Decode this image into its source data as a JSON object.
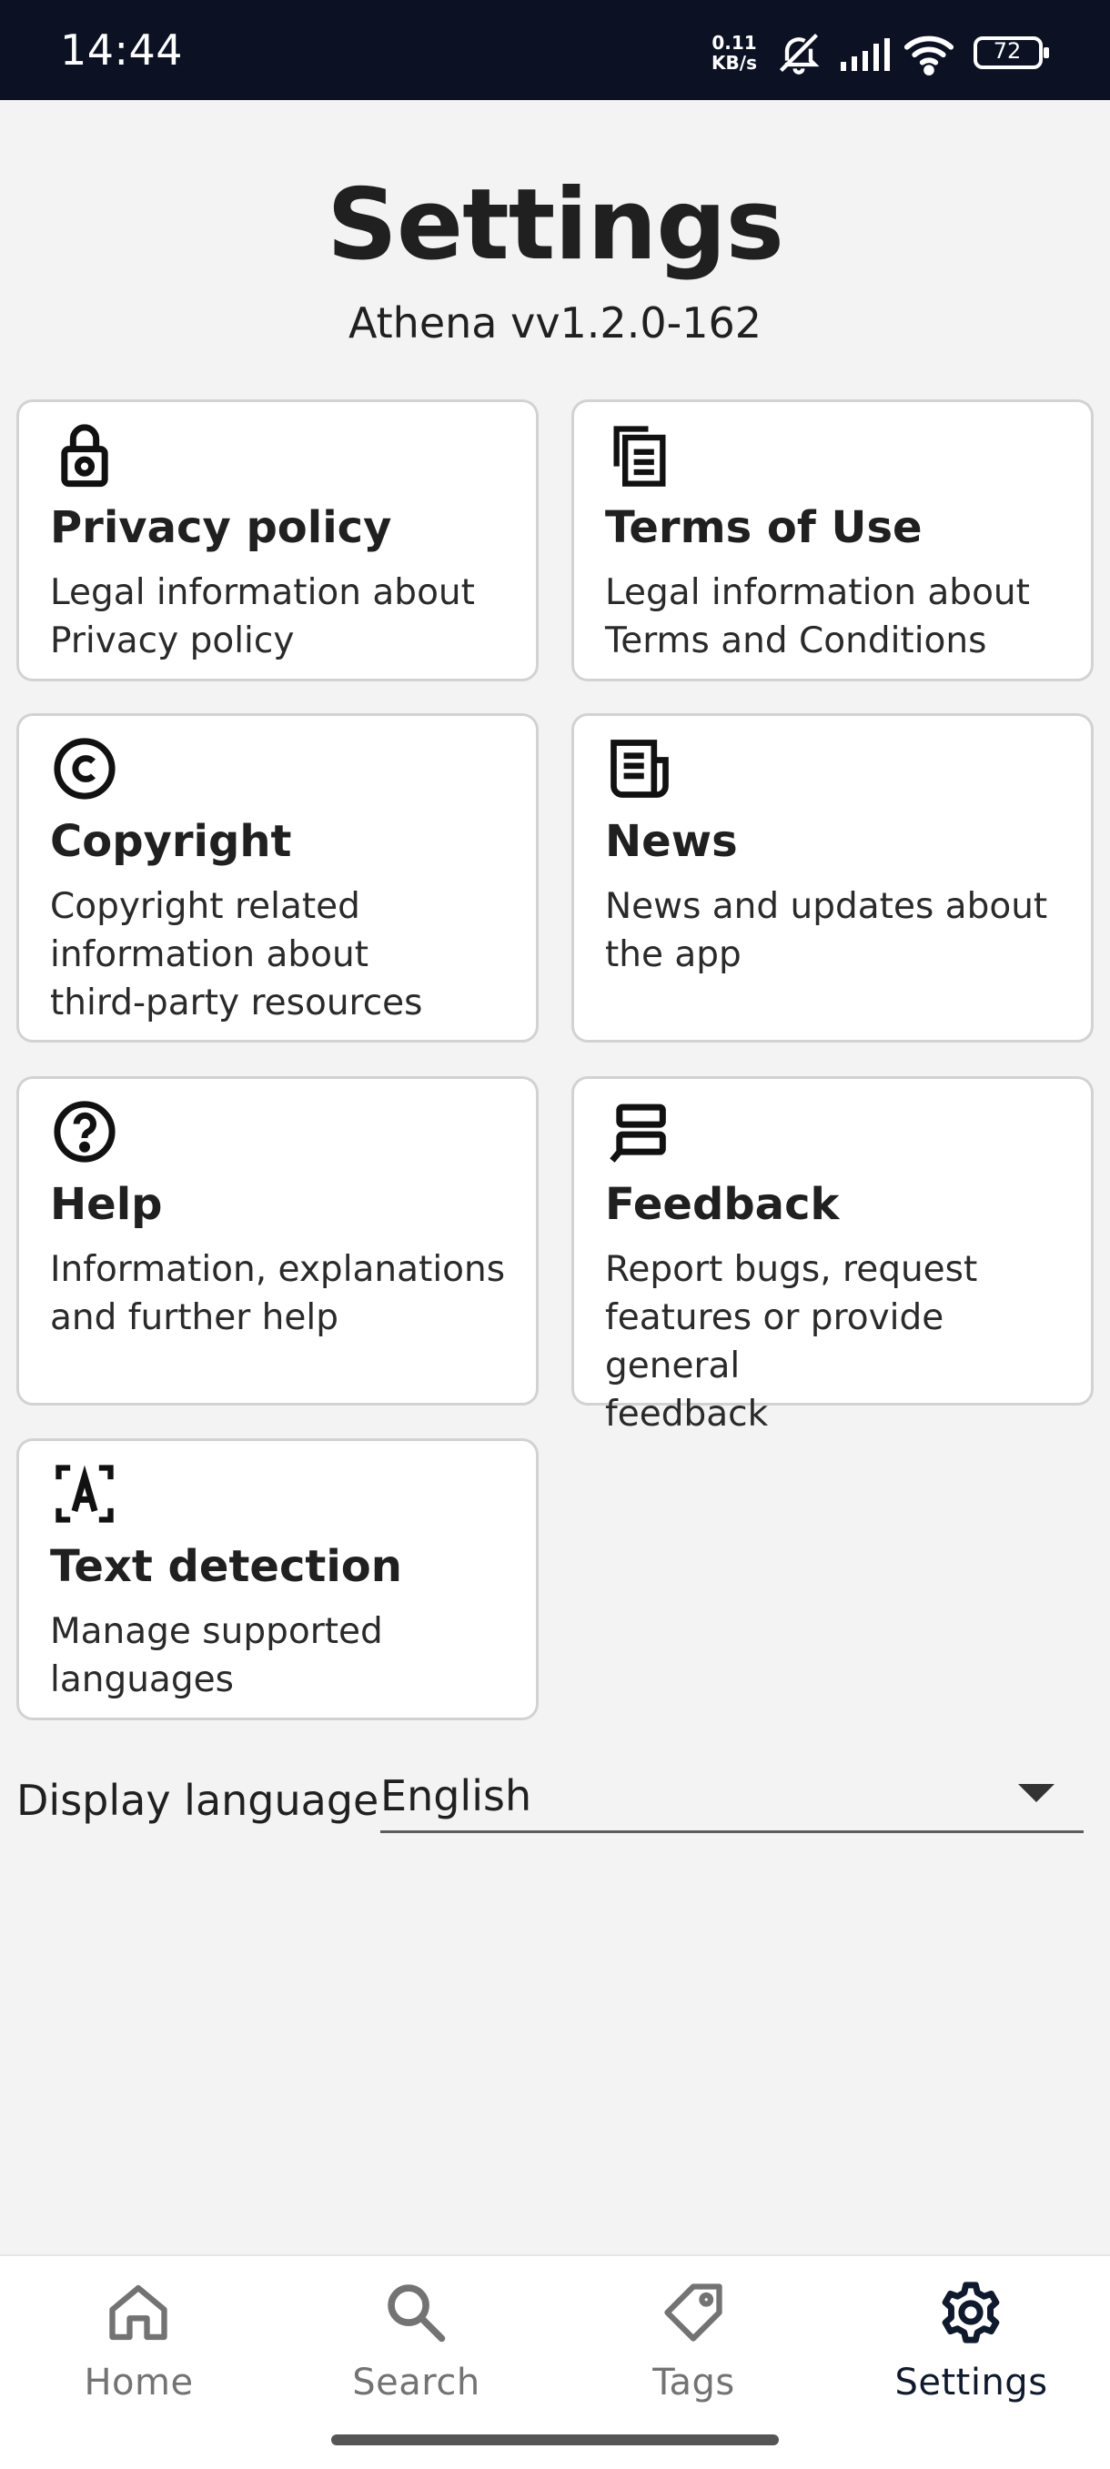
{
  "status_bar": {
    "time": "14:44",
    "net_speed_top": "0.11",
    "net_speed_bottom": "KB/s",
    "battery": "72",
    "icons": [
      "mute-icon",
      "signal-icon",
      "wifi-icon",
      "battery-icon"
    ]
  },
  "header": {
    "title": "Settings",
    "version": "Athena vv1.2.0-162"
  },
  "cards": [
    {
      "title": "Privacy policy",
      "desc": "Legal information about\nPrivacy policy",
      "icon": "lock-icon"
    },
    {
      "title": "Terms of Use",
      "desc": "Legal information about\nTerms and Conditions",
      "icon": "documents-icon"
    },
    {
      "title": "Copyright",
      "desc": "Copyright related\ninformation about\nthird-party resources",
      "icon": "copyright-icon"
    },
    {
      "title": "News",
      "desc": "News and updates about\nthe app",
      "icon": "newspaper-icon"
    },
    {
      "title": "Help",
      "desc": "Information, explanations\nand further help",
      "icon": "help-icon"
    },
    {
      "title": "Feedback",
      "desc": "Report bugs, request\nfeatures or provide general\nfeedback",
      "icon": "feedback-icon"
    },
    {
      "title": "Text detection",
      "desc": "Manage supported\nlanguages",
      "icon": "text-scan-icon"
    }
  ],
  "display_language": {
    "label": "Display language",
    "value": "English"
  },
  "bottom_nav": {
    "items": [
      {
        "label": "Home",
        "icon": "home-icon"
      },
      {
        "label": "Search",
        "icon": "search-icon"
      },
      {
        "label": "Tags",
        "icon": "tag-icon"
      },
      {
        "label": "Settings",
        "icon": "gear-icon",
        "active": true
      }
    ]
  },
  "colors": {
    "status_bar_bg": "#0c1124",
    "page_bg": "#f3f3f3",
    "card_border": "#d2d2d2",
    "nav_active": "#0f1a2e",
    "nav_inactive": "#737373"
  }
}
